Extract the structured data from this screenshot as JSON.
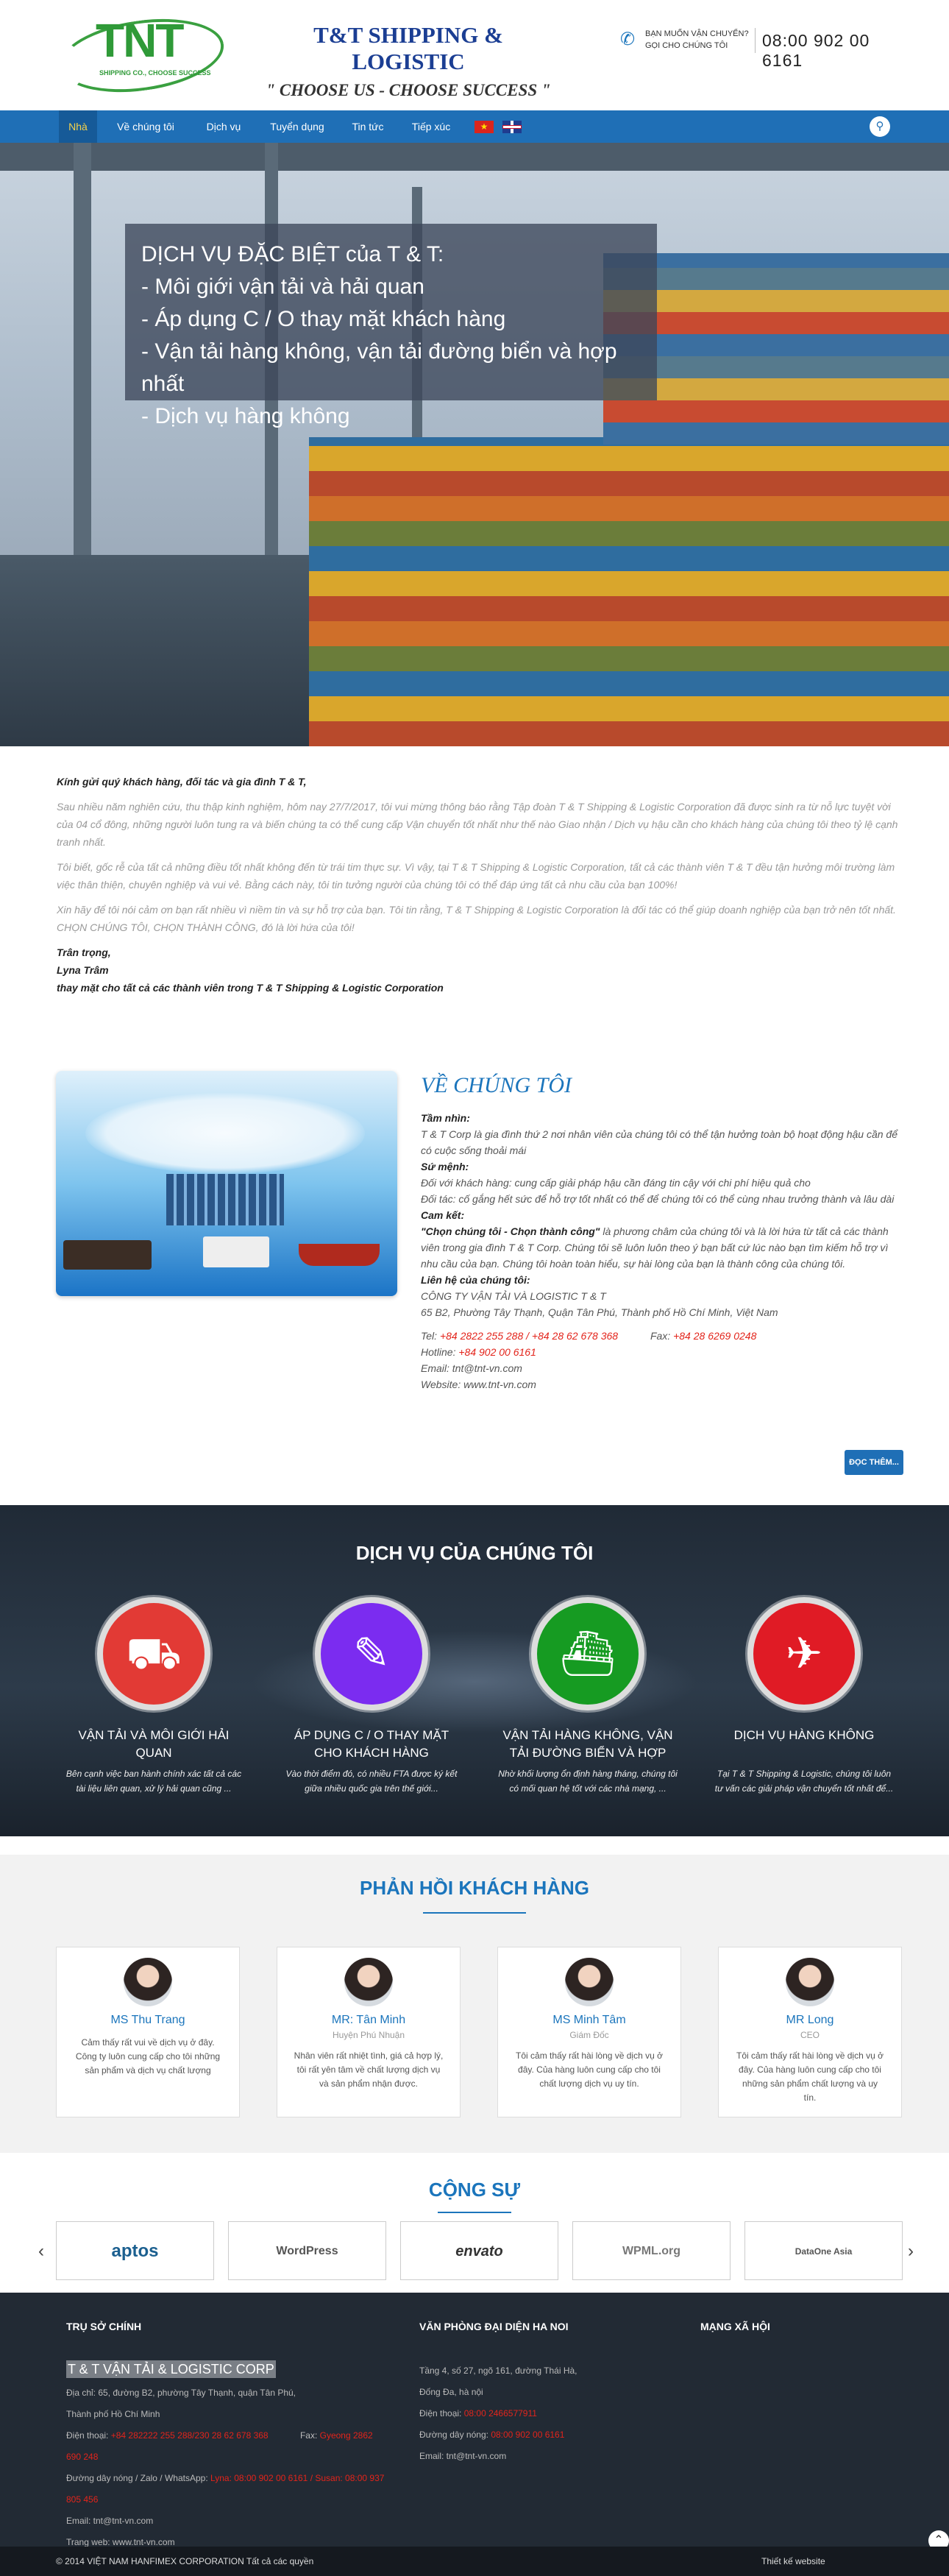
{
  "header": {
    "logo_text": "TNT",
    "logo_sub": "SHIPPING CO., CHOOSE SUCCESS",
    "brand_title": "T&T SHIPPING & LOGISTIC",
    "brand_slogan": "\" CHOOSE US - CHOOSE SUCCESS \"",
    "hotline_question": "BẠN MUỐN VẬN CHUYỂN?",
    "hotline_call": "GỌI CHO CHÚNG TÔI",
    "hotline_number": "08:00 902 00 6161"
  },
  "nav": {
    "items": [
      {
        "label": "Nhà"
      },
      {
        "label": "Về chúng tôi"
      },
      {
        "label": "Dịch vụ"
      },
      {
        "label": "Tuyển dụng"
      },
      {
        "label": "Tin tức"
      },
      {
        "label": "Tiếp xúc"
      }
    ],
    "search_icon": "search-icon",
    "flags": [
      "flag-vn",
      "flag-uk"
    ]
  },
  "hero": {
    "lines": [
      "DỊCH VỤ ĐẶC BIỆT của T & T:",
      "- Môi giới vận tải và hải quan",
      "- Áp dụng C / O thay mặt khách hàng",
      "- Vận tải hàng không, vận tải đường biển và hợp nhất",
      "- Dịch vụ hàng không"
    ]
  },
  "letter": {
    "greeting": "Kính gửi quý khách hàng, đối tác và gia đình T & T,",
    "p1": "Sau nhiều năm nghiên cứu, thu thập kinh nghiệm, hôm nay 27/7/2017, tôi vui mừng thông báo rằng Tập đoàn T & T Shipping & Logistic Corporation đã được sinh ra từ nỗ lực tuyệt vời của 04 cổ đông, những người luôn tung ra và biến chúng ta có thể cung cấp Vận chuyển tốt nhất như thế nào Giao nhận / Dịch vụ hậu cần cho khách hàng của chúng tôi theo tỷ lệ cạnh tranh nhất.",
    "p2": "Tôi biết, gốc rễ của tất cả những điều tốt nhất không đến từ trái tim thực sự. Vì vậy, tại T & T Shipping & Logistic Corporation, tất cả các thành viên T & T đều tận hưởng môi trường làm việc thân thiện, chuyên nghiệp và vui vẻ. Bằng cách này, tôi tin tưởng người của chúng tôi có thể đáp ứng tất cả nhu cầu của bạn 100%!",
    "p3": "Xin hãy để tôi nói cảm ơn bạn rất nhiều vì niềm tin và sự hỗ trợ của bạn. Tôi tin rằng, T & T Shipping & Logistic Corporation là đối tác có thể giúp doanh nghiệp của bạn trở nên tốt nhất. CHỌN CHÚNG TÔI, CHỌN THÀNH CÔNG, đó là lời hứa của tôi!",
    "sign1": "Trân trọng,",
    "sign2": "Lyna Trâm",
    "sign3": "thay mặt cho tất cả các thành viên trong T & T Shipping & Logistic Corporation"
  },
  "about": {
    "title": "VỀ CHÚNG TÔI",
    "vision_h": "Tầm nhìn:",
    "vision": "T & T Corp là gia đình thứ 2 nơi nhân viên của chúng tôi có thể tận hưởng toàn bộ hoạt động hậu cần để có cuộc sống thoải mái",
    "mission_h": "Sứ mệnh:",
    "mission1": "Đối với khách hàng: cung cấp giải pháp hậu cần đáng tin cậy với chi phí hiệu quả cho",
    "mission2": "Đối tác: cố gắng hết sức để hỗ trợ tốt nhất có thể để chúng tôi có thể cùng nhau trưởng thành và lâu dài",
    "commit_h": "Cam kết:",
    "commit_bold": "\"Chọn chúng tôi - Chọn thành công\"",
    "commit": " là phương châm của chúng tôi và là lời hứa từ tất cả các thành viên trong gia đình T & T Corp. Chúng tôi sẽ luôn luôn theo ý bạn bất cứ lúc nào bạn tìm kiếm hỗ trợ vì nhu cầu của bạn. Chúng tôi hoàn toàn hiểu, sự hài lòng của bạn là thành công của chúng tôi.",
    "contact_h": "Liên hệ của chúng tôi:",
    "company": "CÔNG TY VẬN TẢI VÀ LOGISTIC T & T",
    "address": "65 B2, Phường Tây Thạnh, Quận Tân Phú, Thành phố Hồ Chí Minh, Việt Nam",
    "tel_label": "Tel:",
    "tel": "+84 2822 255 288 / +84 28 62 678 368",
    "fax_label": "Fax:",
    "fax": "+84 28 6269 0248",
    "hotline_label": "Hotline:",
    "hotline": "+84 902 00 6161",
    "email": "Email: tnt@tnt-vn.com",
    "website": "Website: www.tnt-vn.com",
    "more": "ĐỌC THÊM..."
  },
  "services": {
    "title": "DỊCH VỤ CỦA CHÚNG TÔI",
    "items": [
      {
        "name": "VẬN TẢI VÀ MÔI GIỚI HẢI QUAN",
        "desc": "Bên cạnh việc ban hành chính xác tất cả các tài liệu liên quan, xử lý hải quan cũng ...",
        "color": "#e23a35",
        "icon": "truck-icon"
      },
      {
        "name": "ÁP DỤNG C / O THAY MẶT CHO KHÁCH HÀNG",
        "desc": "Vào thời điểm đó, có nhiều FTA được ký kết giữa nhiều quốc gia trên thế giới...",
        "color": "#7b2cf0",
        "icon": "document-icon"
      },
      {
        "name": "VẬN TẢI HÀNG KHÔNG, VẬN TẢI ĐƯỜNG BIỂN VÀ HỢP",
        "desc": "Nhờ khối lượng ổn định hàng tháng, chúng tôi có mối quan hệ tốt với các nhà mạng, ...",
        "color": "#169b22",
        "icon": "cart-icon"
      },
      {
        "name": "DỊCH VỤ HÀNG KHÔNG",
        "desc": "Tại T & T Shipping & Logistic, chúng tôi luôn tư vấn các giải pháp vận chuyển tốt nhất để...",
        "color": "#e01b25",
        "icon": "plane-icon"
      }
    ]
  },
  "testimonials": {
    "title": "PHẢN HỒI KHÁCH HÀNG",
    "items": [
      {
        "name": "MS Thu Trang",
        "role": "",
        "text": "Cảm thấy rất vui về dịch vụ ở đây. Công ty luôn cung cấp cho tôi những sản phẩm và dịch vụ chất lượng"
      },
      {
        "name": "MR: Tân Minh",
        "role": "Huyện Phú Nhuận",
        "text": "Nhân viên rất nhiệt tình, giá cả hợp lý, tôi rất yên tâm về chất lượng dịch vụ và sản phẩm nhận được."
      },
      {
        "name": "MS Minh Tâm",
        "role": "Giám Đốc",
        "text": "Tôi cảm thấy rất hài lòng về dịch vụ ở đây. Của hàng luôn cung cấp cho tôi chất lượng dịch vụ uy tín."
      },
      {
        "name": "MR Long",
        "role": "CEO",
        "text": "Tôi cảm thấy rất hài lòng về dịch vụ ở đây. Của hàng luôn cung cấp cho tôi những sản phẩm chất lượng và uy tín."
      }
    ]
  },
  "partners": {
    "title": "CỘNG SỰ",
    "items": [
      "aptos",
      "WordPress",
      "envato",
      "WPML.org",
      "DataOne Asia"
    ],
    "prev": "‹",
    "next": "›"
  },
  "footer": {
    "col1": {
      "title": "TRỤ SỞ CHÍNH",
      "company": "T & T VẬN TẢI & LOGISTIC CORP",
      "addr1": "Địa chỉ: 65, đường B2, phường Tây Thạnh, quận Tân Phú,",
      "addr2": "Thành phố Hồ Chí Minh",
      "tel_label": "Điện thoại:",
      "tel": "+84 282222 255 288/230  28 62 678 368",
      "fax_label": "Fax:",
      "fax": "Gyeong 2862 690 248",
      "hotline_label": "Đường dây nóng / Zalo / WhatsApp:",
      "hotline": "Lyna: 08:00 902 00 6161 / Susan: 08:00  937 805 456",
      "email": "Email: tnt@tnt-vn.com",
      "web": "Trang web: www.tnt-vn.com"
    },
    "col2": {
      "title": "VĂN PHÒNG ĐẠI DIỆN HA NOI",
      "addr1": "Tầng 4, số 27, ngõ 161, đường Thái Hà,",
      "addr2": "Đống Đa, hà nội",
      "tel_label": "Điện thoại:",
      "tel": "08:00 2466577911",
      "hotline_label": "Đường dây nóng:",
      "hotline": "08:00 902 00 6161",
      "email": "Email: tnt@tnt-vn.com"
    },
    "col3": {
      "title": "MẠNG XÃ HỘI"
    },
    "copyright": "© 2014 VIỆT NAM HANFIMEX CORPORATION Tất cả các quyền",
    "design": "Thiết kế website"
  }
}
